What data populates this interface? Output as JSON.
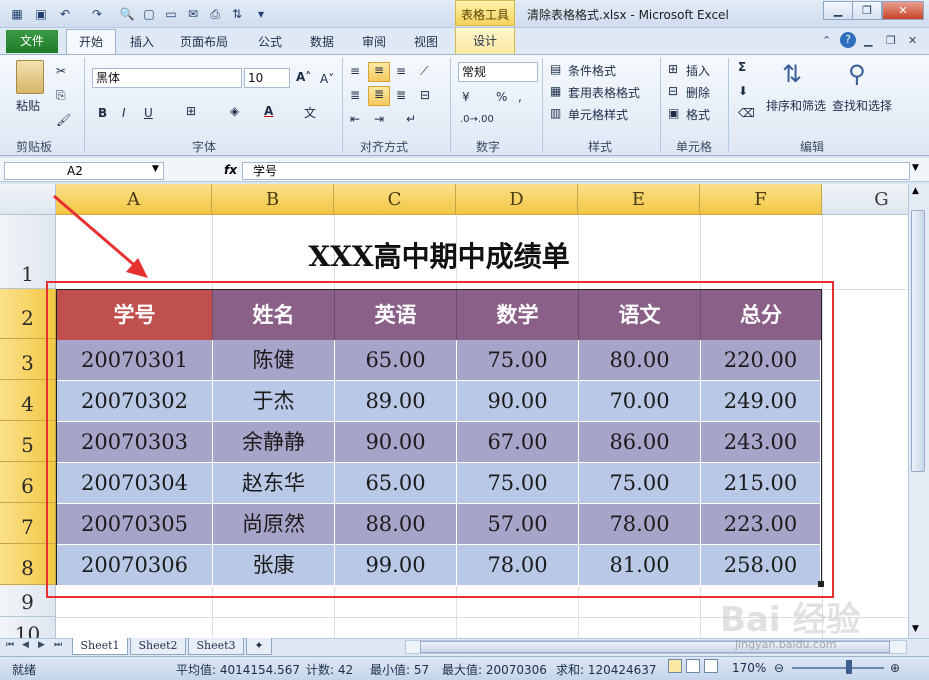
{
  "window": {
    "title": "清除表格格式.xlsx - Microsoft Excel",
    "context_tab": "表格工具"
  },
  "tabs": [
    "文件",
    "开始",
    "插入",
    "页面布局",
    "公式",
    "数据",
    "审阅",
    "视图",
    "设计"
  ],
  "ribbon": {
    "clipboard": {
      "paste": "粘贴",
      "label": "剪贴板"
    },
    "font": {
      "name": "黑体",
      "size": "10",
      "bold": "B",
      "italic": "I",
      "underline": "U",
      "label": "字体"
    },
    "alignment": {
      "label": "对齐方式"
    },
    "number": {
      "format": "常规",
      "label": "数字"
    },
    "styles": {
      "conditional": "条件格式",
      "table_format": "套用表格格式",
      "cell_styles": "单元格样式",
      "label": "样式"
    },
    "cells": {
      "insert": "插入",
      "delete": "删除",
      "format": "格式",
      "label": "单元格"
    },
    "editing": {
      "sort_filter": "排序和筛选",
      "find_select": "查找和选择",
      "label": "编辑"
    }
  },
  "formula_bar": {
    "name_box": "A2",
    "fx": "fx",
    "content": "学号"
  },
  "columns": [
    "A",
    "B",
    "C",
    "D",
    "E",
    "F",
    "G"
  ],
  "rows": [
    "1",
    "2",
    "3",
    "4",
    "5",
    "6",
    "7",
    "8",
    "9",
    "10"
  ],
  "sheet": {
    "title": "XXX高中期中成绩单",
    "headers": [
      "学号",
      "姓名",
      "英语",
      "数学",
      "语文",
      "总分"
    ],
    "data": [
      [
        "20070301",
        "陈健",
        "65.00",
        "75.00",
        "80.00",
        "220.00"
      ],
      [
        "20070302",
        "于杰",
        "89.00",
        "90.00",
        "70.00",
        "249.00"
      ],
      [
        "20070303",
        "余静静",
        "90.00",
        "67.00",
        "86.00",
        "243.00"
      ],
      [
        "20070304",
        "赵东华",
        "65.00",
        "75.00",
        "75.00",
        "215.00"
      ],
      [
        "20070305",
        "尚原然",
        "88.00",
        "57.00",
        "78.00",
        "223.00"
      ],
      [
        "20070306",
        "张康",
        "99.00",
        "78.00",
        "81.00",
        "258.00"
      ]
    ]
  },
  "sheet_tabs": [
    "Sheet1",
    "Sheet2",
    "Sheet3"
  ],
  "status": {
    "ready": "就绪",
    "average": "平均值: 4014154.567",
    "count": "计数: 42",
    "min": "最小值: 57",
    "max": "最大值: 20070306",
    "sum": "求和: 120424637",
    "zoom": "170%"
  },
  "watermark": {
    "logo": "Bai 经验",
    "url": "jingyan.baidu.com"
  },
  "colors": {
    "header_first": "#c0504d",
    "header": "#8a6088",
    "row_odd": "#a7a4c9",
    "row_even": "#b8c8e6",
    "annotation": "#e83030"
  }
}
